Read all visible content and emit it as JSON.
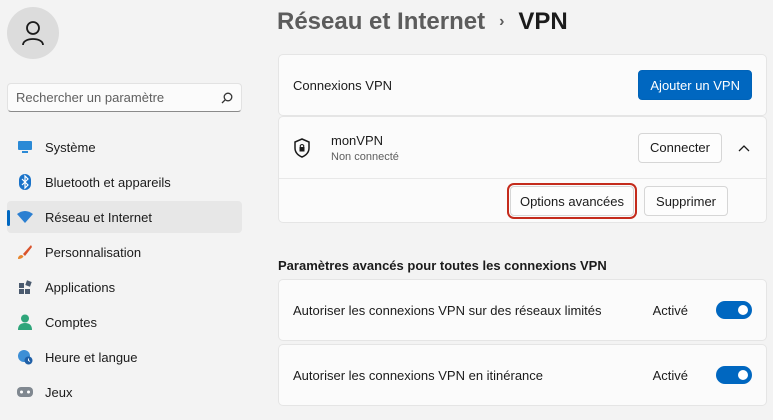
{
  "sidebar": {
    "search_placeholder": "Rechercher un paramètre",
    "items": [
      {
        "label": "Système",
        "icon": "monitor-icon"
      },
      {
        "label": "Bluetooth et appareils",
        "icon": "bluetooth-icon"
      },
      {
        "label": "Réseau et Internet",
        "icon": "wifi-icon",
        "active": true
      },
      {
        "label": "Personnalisation",
        "icon": "brush-icon"
      },
      {
        "label": "Applications",
        "icon": "apps-icon"
      },
      {
        "label": "Comptes",
        "icon": "person-icon"
      },
      {
        "label": "Heure et langue",
        "icon": "globe-clock-icon"
      },
      {
        "label": "Jeux",
        "icon": "gamepad-icon"
      }
    ]
  },
  "header": {
    "parent": "Réseau et Internet",
    "separator": "›",
    "current": "VPN"
  },
  "vpn_connections": {
    "label": "Connexions VPN",
    "add_button": "Ajouter un VPN"
  },
  "vpn_item": {
    "name": "monVPN",
    "status": "Non connecté",
    "connect_button": "Connecter",
    "advanced_button": "Options avancées",
    "delete_button": "Supprimer"
  },
  "advanced": {
    "section_title": "Paramètres avancés pour toutes les connexions VPN",
    "settings": [
      {
        "label": "Autoriser les connexions VPN sur des réseaux limités",
        "state": "Activé"
      },
      {
        "label": "Autoriser les connexions VPN en itinérance",
        "state": "Activé"
      }
    ]
  },
  "colors": {
    "accent": "#0067c0",
    "highlight": "#c42b1c"
  }
}
